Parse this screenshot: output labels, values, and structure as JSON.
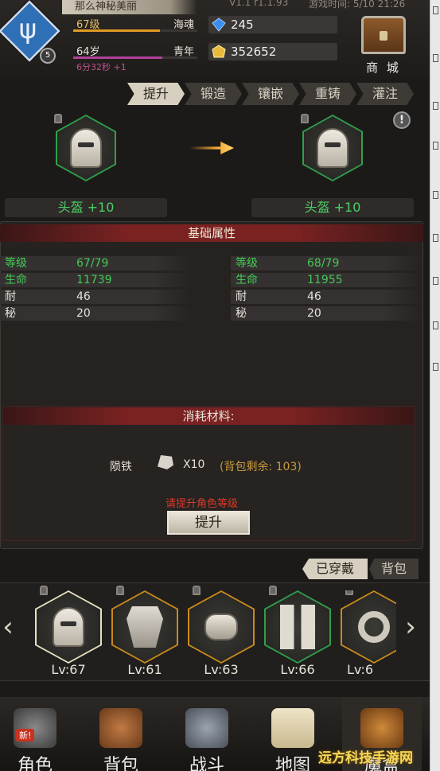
{
  "player": {
    "name": "那么神秘美丽",
    "level_text": "67级",
    "level_title": "海魂",
    "level_progress": 0.7,
    "age_text": "64岁",
    "age_title": "青年",
    "age_progress": 0.72,
    "timer": "6分32秒 +1",
    "badge": "5"
  },
  "resources": {
    "gems": "245",
    "gold": "352652"
  },
  "version": "V1.1 r1.1.93",
  "game_time": "游戏时间: 5/10 21:26",
  "shop_label": "商 城",
  "tabs": [
    "提升",
    "锻造",
    "镶嵌",
    "重铸",
    "灌注"
  ],
  "compare": {
    "left_name": "头盔 +10",
    "right_name": "头盔 +10"
  },
  "stats": {
    "title": "基础属性",
    "left": [
      {
        "k": "等级",
        "v": "67/79"
      },
      {
        "k": "生命",
        "v": "11739"
      },
      {
        "k": "耐",
        "v": "46"
      },
      {
        "k": "秘",
        "v": "20"
      }
    ],
    "right": [
      {
        "k": "等级",
        "v": "68/79"
      },
      {
        "k": "生命",
        "v": "11955"
      },
      {
        "k": "耐",
        "v": "46"
      },
      {
        "k": "秘",
        "v": "20"
      }
    ]
  },
  "cost": {
    "title": "消耗材料:",
    "material": "陨铁",
    "qty": "X10",
    "remain": "(背包剩余: 103)",
    "warning": "请提升角色等级",
    "button": "提升"
  },
  "wear_tabs": {
    "worn": "已穿戴",
    "bag": "背包"
  },
  "items": [
    {
      "lv": "Lv:67",
      "frame": "green",
      "icon": "helmet-icon"
    },
    {
      "lv": "Lv:61",
      "frame": "gold",
      "icon": "armor-icon"
    },
    {
      "lv": "Lv:63",
      "frame": "gold",
      "icon": "bracer-icon"
    },
    {
      "lv": "Lv:66",
      "frame": "green",
      "icon": "boots-icon"
    },
    {
      "lv": "Lv:6",
      "frame": "gold",
      "icon": "ring-icon"
    }
  ],
  "nav": [
    {
      "label": "角色",
      "tag": "新!"
    },
    {
      "label": "背包"
    },
    {
      "label": "战斗"
    },
    {
      "label": "地图"
    },
    {
      "label": "魔盒"
    }
  ],
  "watermark": "远方科技手游网",
  "colors": {
    "green_frame": "#2fa04a",
    "gold_frame": "#c98a1a",
    "accent_red": "#7a2222"
  }
}
